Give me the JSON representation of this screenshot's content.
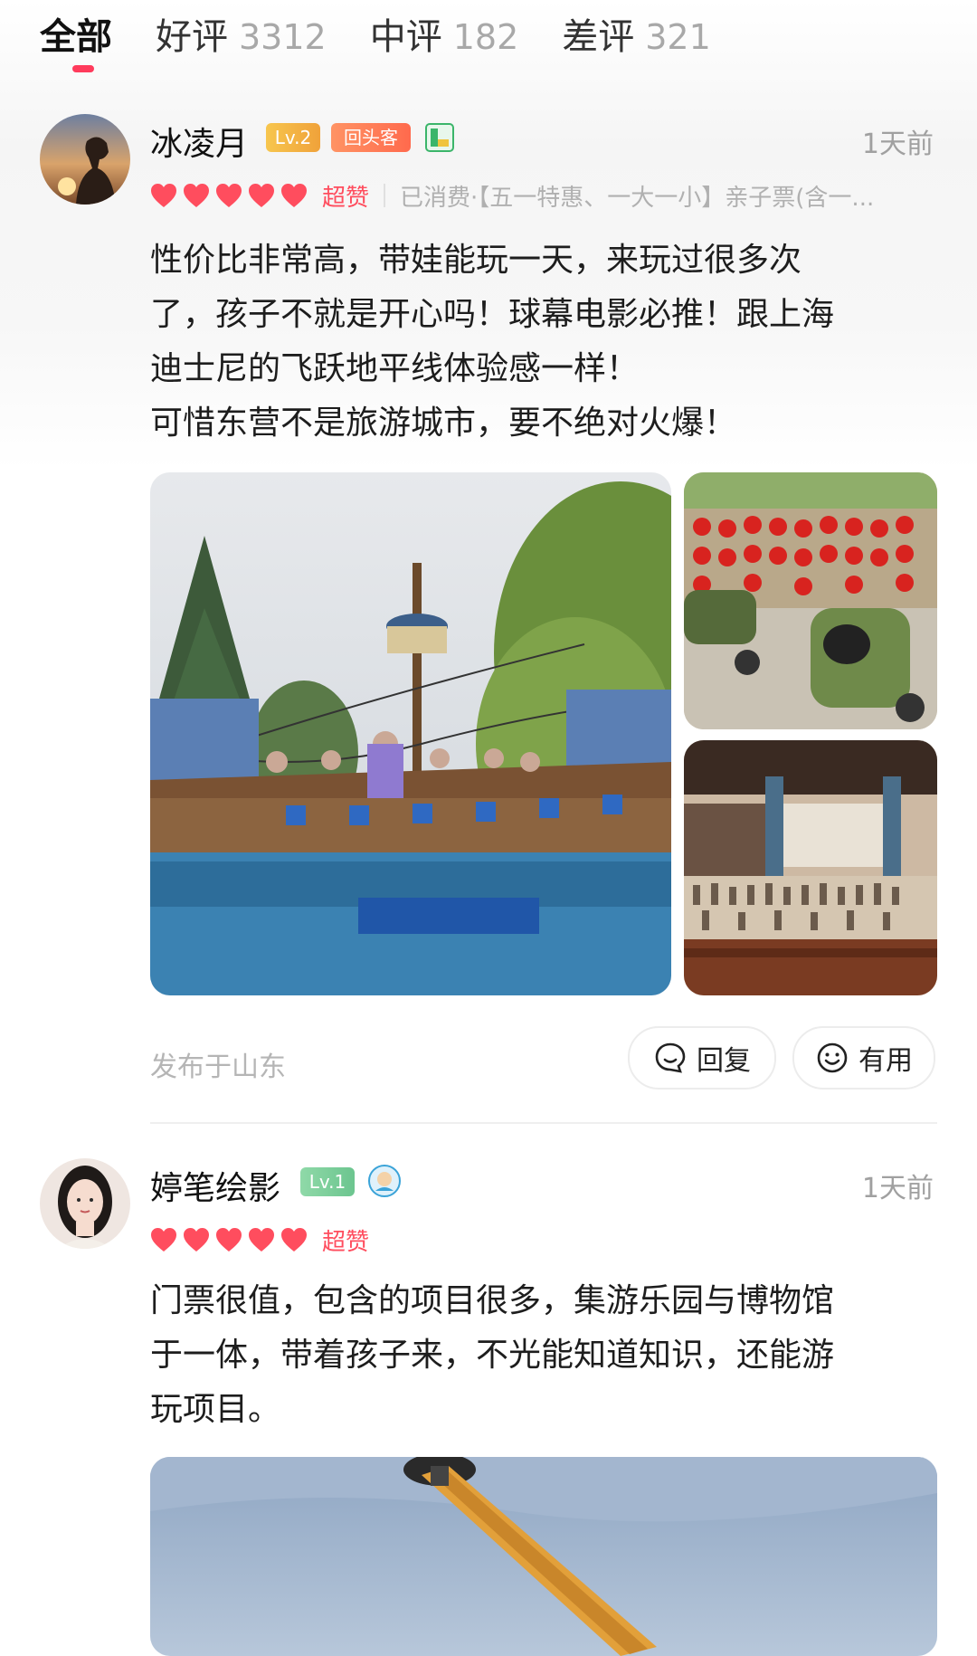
{
  "tabs": [
    {
      "label": "全部",
      "count": ""
    },
    {
      "label": "好评",
      "count": "3312"
    },
    {
      "label": "中评",
      "count": "182"
    },
    {
      "label": "差评",
      "count": "321"
    }
  ],
  "reviews": [
    {
      "username": "冰凌月",
      "level": "Lv.2",
      "tag": "回头客",
      "time": "1天前",
      "rating_text": "超赞",
      "purchase": "已消费·【五一特惠、一大一小】亲子票(含一...",
      "content": [
        "性价比非常高，带娃能玩一天，来玩过很多次",
        "了，孩子不就是开心吗！球幕电影必推！跟上海",
        "迪士尼的飞跃地平线体验感一样！",
        "可惜东营不是旅游城市，要不绝对火爆！"
      ],
      "location": "发布于山东",
      "reply_label": "回复",
      "useful_label": "有用"
    },
    {
      "username": "婷笔绘影",
      "level": "Lv.1",
      "time": "1天前",
      "rating_text": "超赞",
      "content": [
        "门票很值，包含的项目很多，集游乐园与博物馆",
        "于一体，带着孩子来，不光能知道知识，还能游",
        "玩项目。"
      ]
    }
  ],
  "colors": {
    "accent": "#ff3b5c",
    "heart": "#ff4d5e",
    "level2": "#f5b43a",
    "level1": "#7ccf9a",
    "tag": "#ff7a59"
  }
}
